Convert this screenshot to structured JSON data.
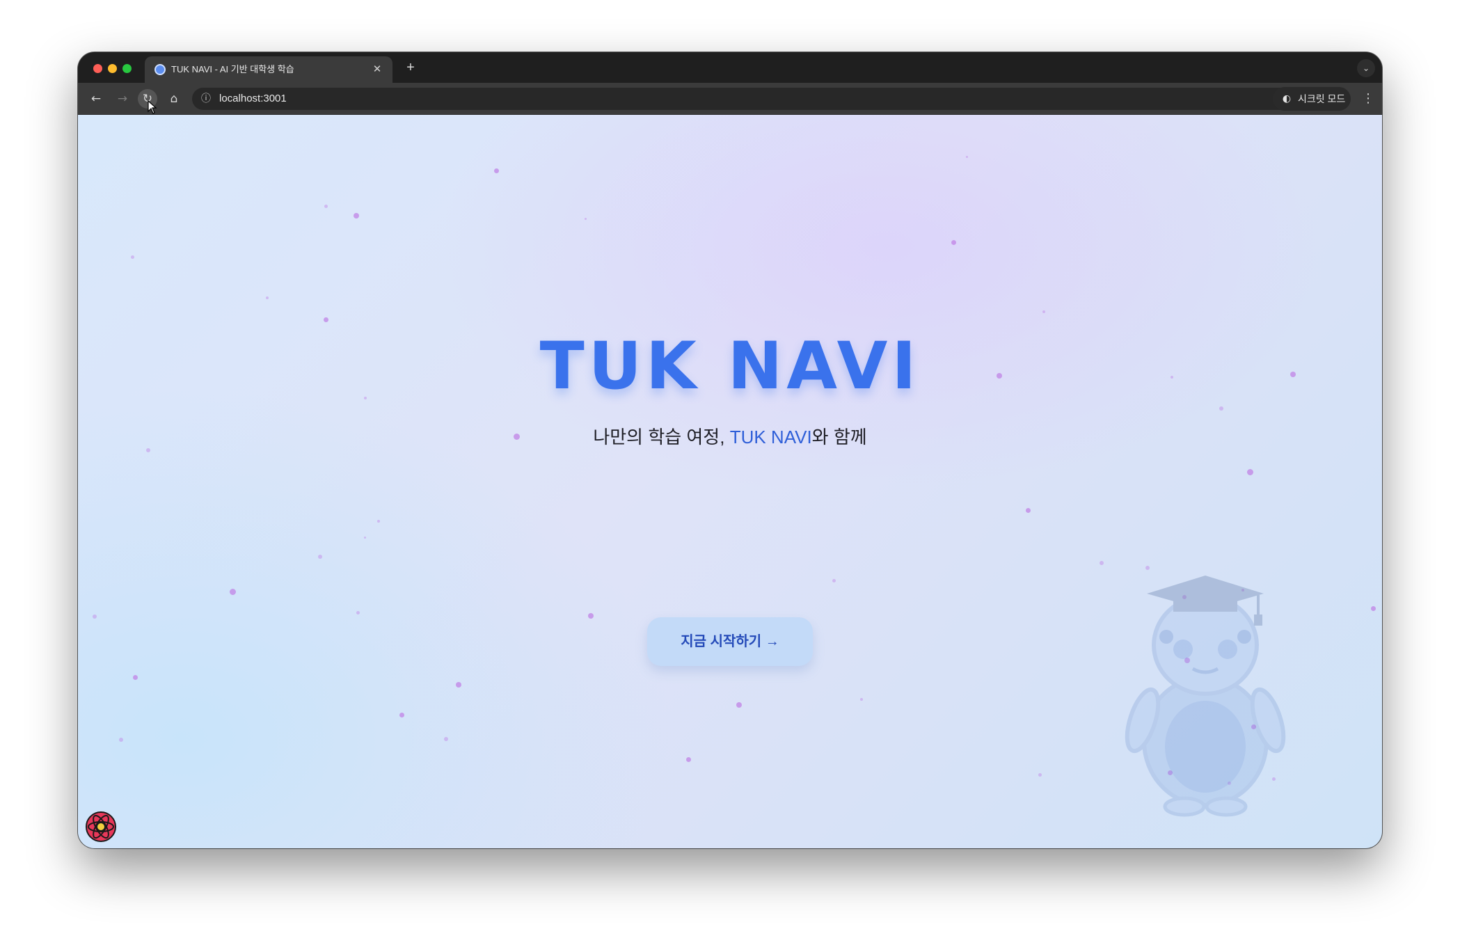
{
  "browser": {
    "tab": {
      "title": "TUK NAVI - AI 기반 대학생 학습",
      "close_icon": "close-icon",
      "favicon": "app-favicon"
    },
    "new_tab_icon": "plus-icon",
    "tab_search_icon": "chevron-down-icon",
    "toolbar": {
      "back_icon": "arrow-left-icon",
      "forward_icon": "arrow-right-icon",
      "reload_icon": "reload-icon",
      "home_icon": "home-icon",
      "site_info_icon": "info-icon",
      "url": "localhost:3001",
      "bookmark_icon": "star-icon",
      "incognito_label": "시크릿 모드",
      "menu_icon": "more-vertical-icon"
    }
  },
  "page": {
    "title": "TUK NAVI",
    "subtitle_prefix": "나만의 학습 여정, ",
    "subtitle_brand": "TUK NAVI",
    "subtitle_suffix": "와 함께",
    "cta_label": "지금 시작하기 →",
    "mascot": "graduation-mascot-illustration",
    "devtools_icon": "react-devtools-icon",
    "colors": {
      "title": "#3a72ec",
      "accent": "#2f5fd8",
      "cta_background": "#c3daf8",
      "particles": "#c083e6"
    }
  }
}
